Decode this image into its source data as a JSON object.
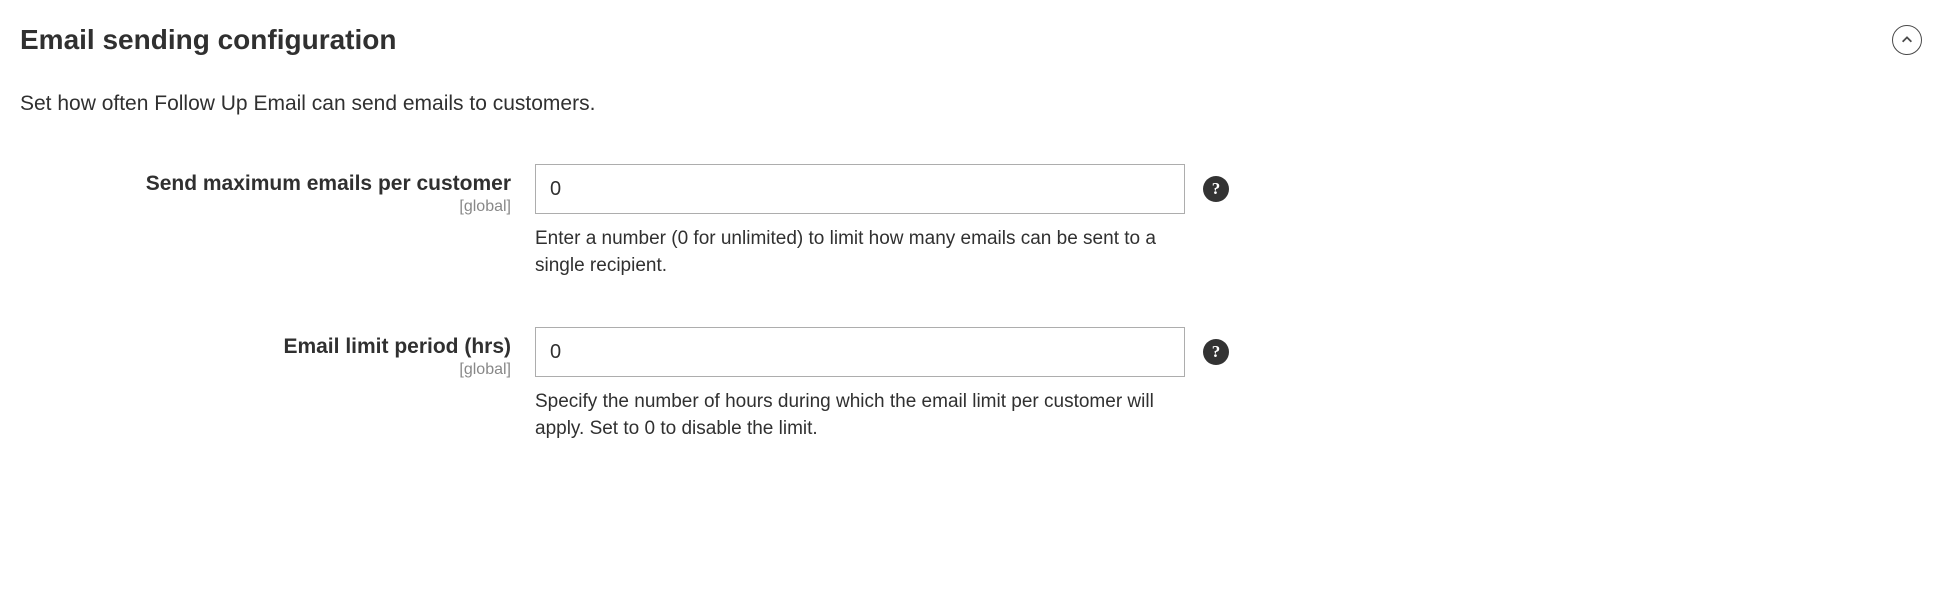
{
  "section": {
    "title": "Email sending configuration",
    "description": "Set how often Follow Up Email can send emails to customers."
  },
  "fields": {
    "max_emails": {
      "label": "Send maximum emails per customer",
      "scope": "[global]",
      "value": "0",
      "note": "Enter a number (0 for unlimited) to limit how many emails can be sent to a single recipient."
    },
    "limit_period": {
      "label": "Email limit period (hrs)",
      "scope": "[global]",
      "value": "0",
      "note": "Specify the number of hours during which the email limit per customer will apply. Set to 0 to disable the limit."
    }
  },
  "help_glyph": "?"
}
